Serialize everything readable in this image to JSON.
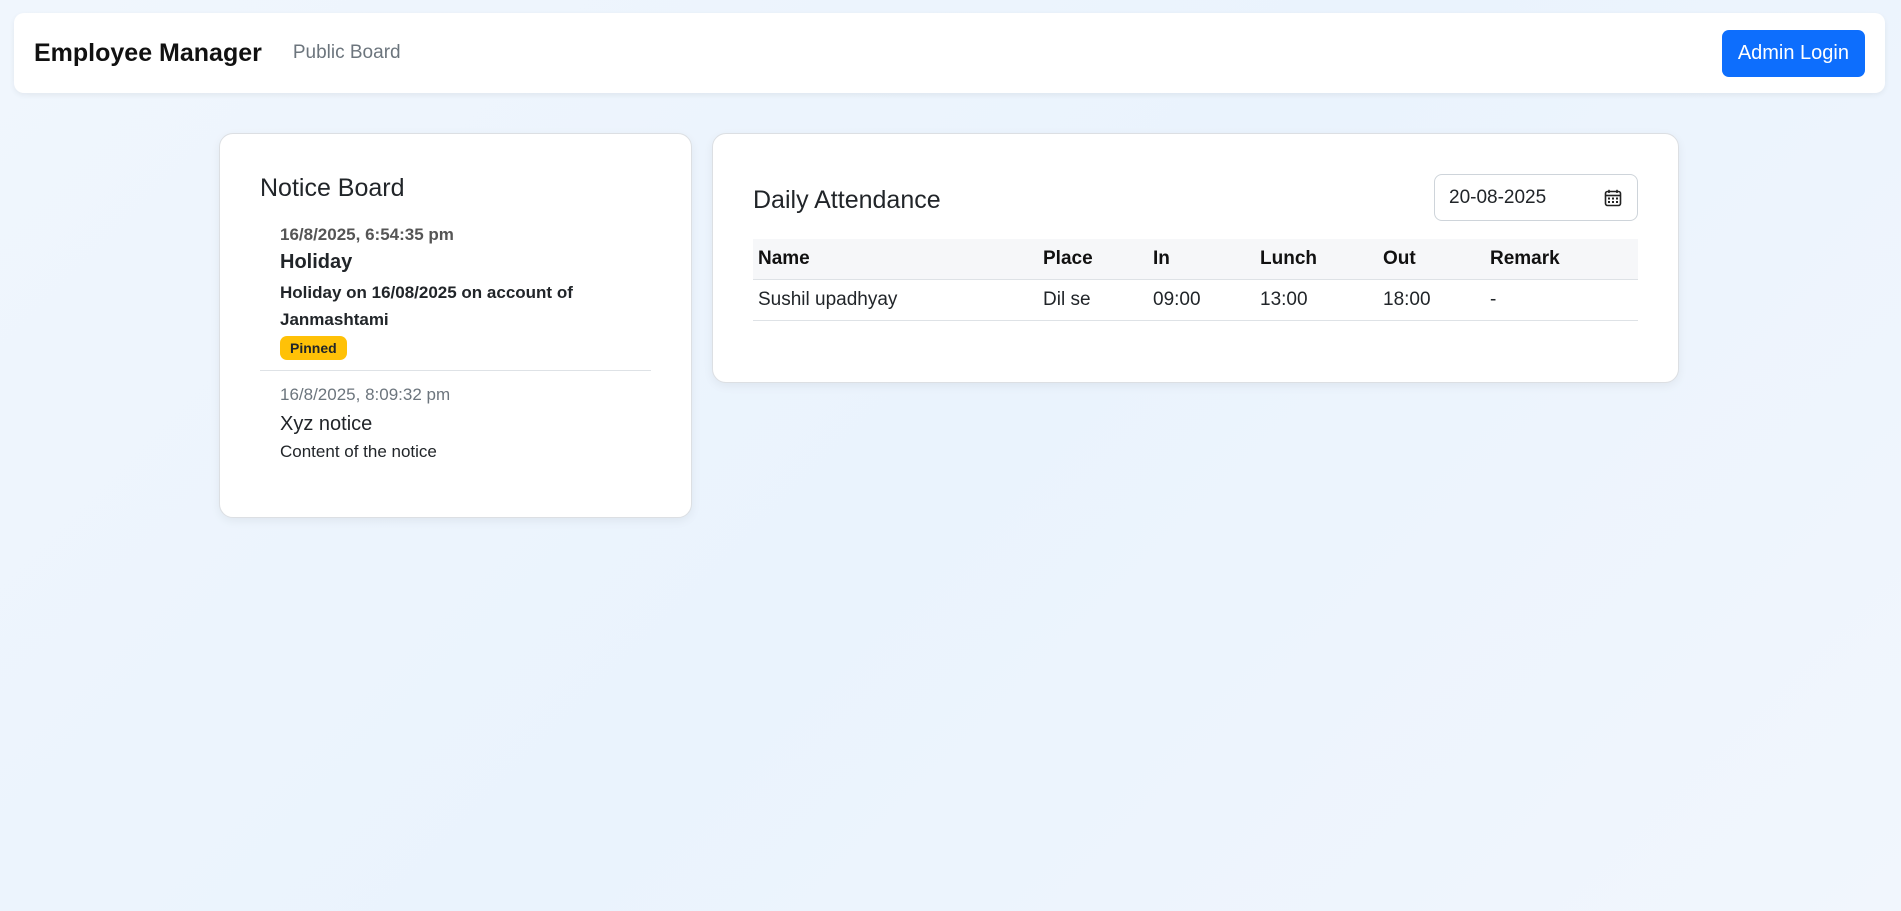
{
  "navbar": {
    "brand": "Employee Manager",
    "public_board_link": "Public Board",
    "admin_login_label": "Admin Login"
  },
  "notice_board": {
    "title": "Notice Board",
    "notices": [
      {
        "date": "16/8/2025, 6:54:35 pm",
        "title": "Holiday",
        "content": "Holiday on 16/08/2025 on account of Janmashtami",
        "badge": "Pinned",
        "pinned": true
      },
      {
        "date": "16/8/2025, 8:09:32 pm",
        "title": "Xyz notice",
        "content": "Content of the notice",
        "pinned": false
      }
    ]
  },
  "attendance": {
    "title": "Daily Attendance",
    "date_value": "20-08-2025",
    "date_icon": "calendar-icon",
    "columns": [
      "Name",
      "Place",
      "In",
      "Lunch",
      "Out",
      "Remark"
    ],
    "rows": [
      [
        "Sushil upadhyay",
        "Dil se",
        "09:00",
        "13:00",
        "18:00",
        "-"
      ]
    ]
  },
  "colors": {
    "primary": "#0d6efd",
    "badge_pinned": "#ffc107"
  }
}
